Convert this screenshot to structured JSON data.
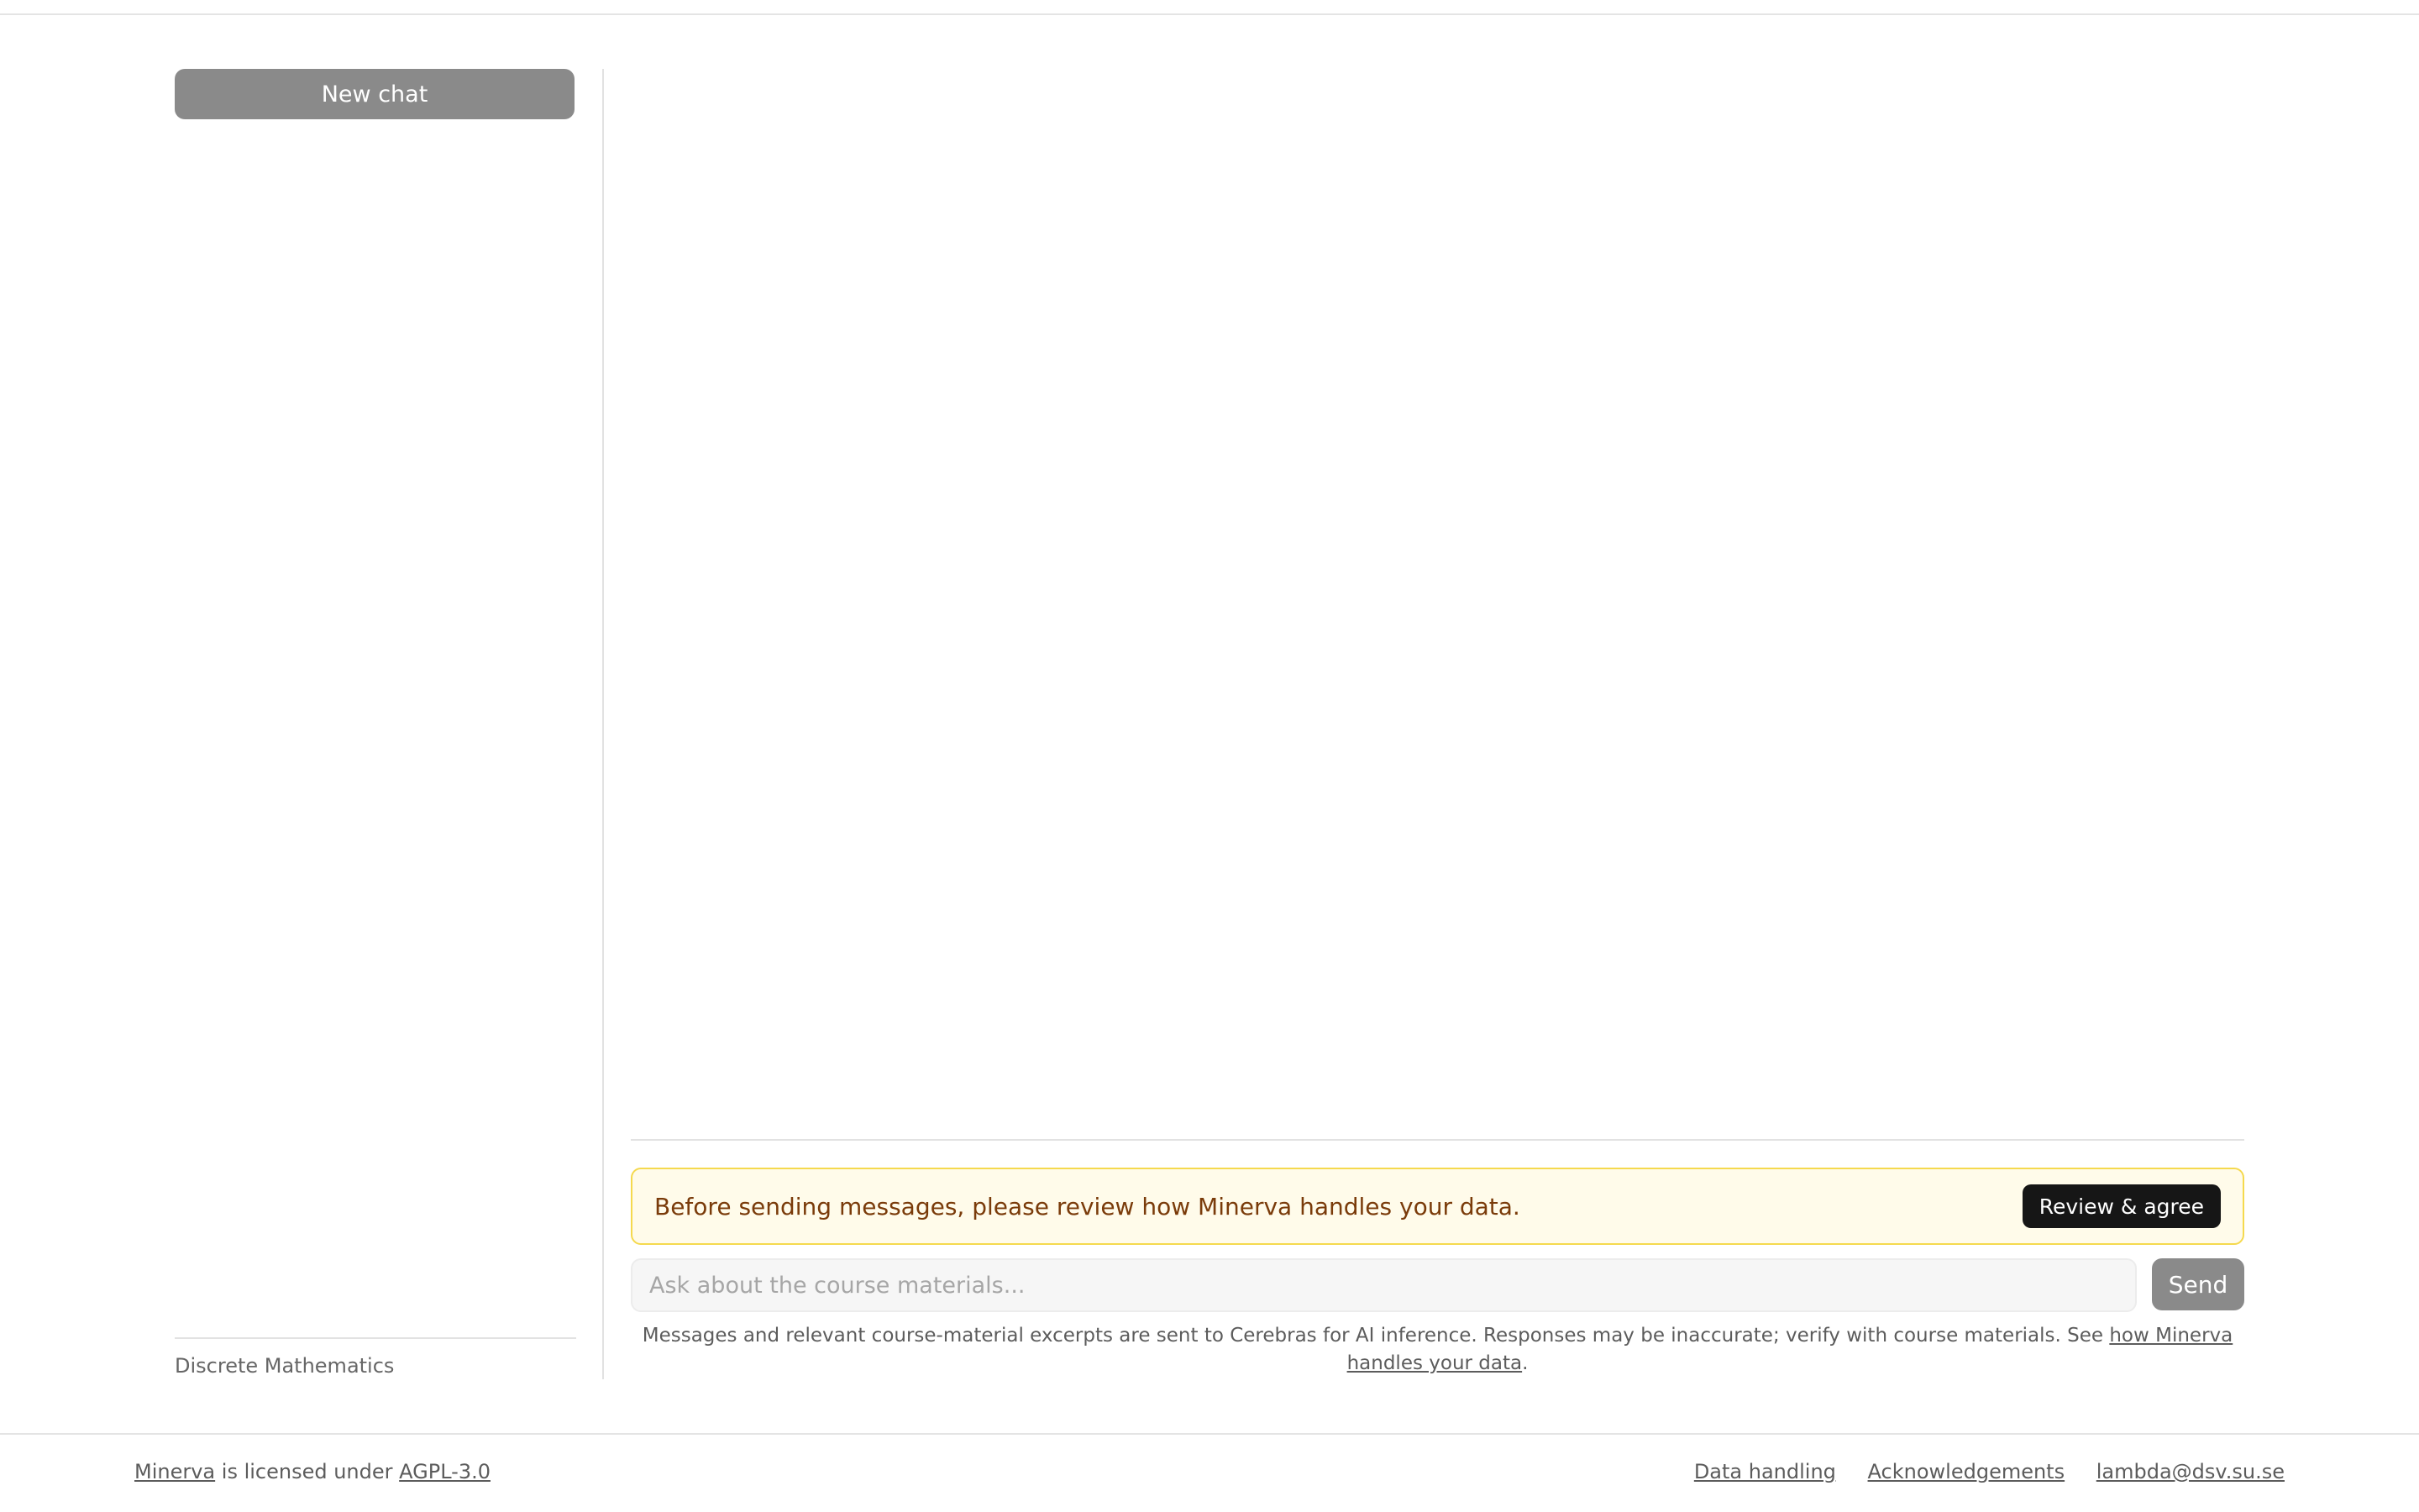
{
  "sidebar": {
    "new_chat_label": "New chat",
    "course_name": "Discrete Mathematics"
  },
  "notice": {
    "text": "Before sending messages, please review how Minerva handles your data.",
    "review_button_label": "Review & agree"
  },
  "composer": {
    "placeholder": "Ask about the course materials...",
    "value": "",
    "send_label": "Send"
  },
  "disclaimer": {
    "text": "Messages and relevant course-material excerpts are sent to Cerebras for AI inference. Responses may be inaccurate; verify with course materials. See ",
    "link_text": "how Minerva handles your data",
    "suffix": "."
  },
  "footer": {
    "project_link": "Minerva",
    "license_text": " is licensed under ",
    "license_link": "AGPL-3.0",
    "links": [
      "Data handling",
      "Acknowledgements",
      "lambda@dsv.su.se"
    ]
  },
  "colors": {
    "notice_background": "#fffbea",
    "notice_border": "#f5d94e",
    "notice_text": "#7a3b0a",
    "primary_dark": "#161616",
    "disabled_button": "#8a8a8a"
  }
}
